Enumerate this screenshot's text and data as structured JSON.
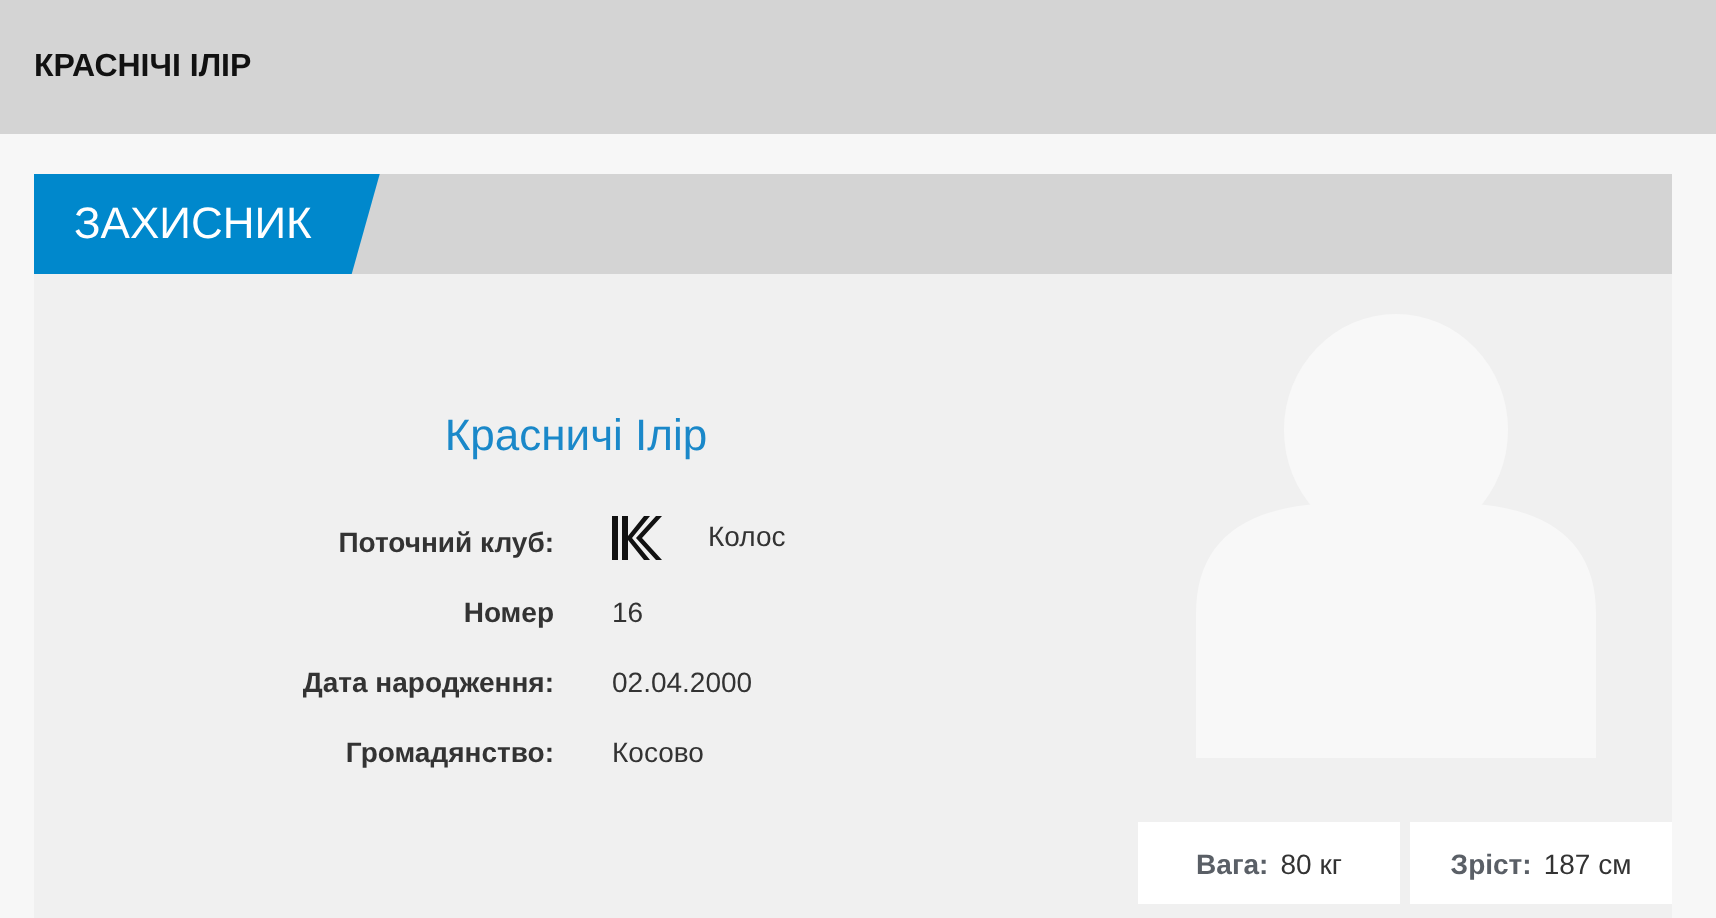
{
  "page_title": "КРАСНІЧІ ІЛІР",
  "position": "ЗАХИСНИК",
  "player_name": "Красничі Ілір",
  "details": [
    {
      "label": "Поточний клуб:",
      "value": "Колос",
      "kind": "club"
    },
    {
      "label": "Номер",
      "value": "16",
      "kind": "text"
    },
    {
      "label": "Дата народження:",
      "value": "02.04.2000",
      "kind": "text"
    },
    {
      "label": "Громадянство:",
      "value": "Косово",
      "kind": "text"
    }
  ],
  "stats": [
    {
      "label": "Вага:",
      "value": "80 кг"
    },
    {
      "label": "Зріст:",
      "value": "187 см"
    }
  ]
}
